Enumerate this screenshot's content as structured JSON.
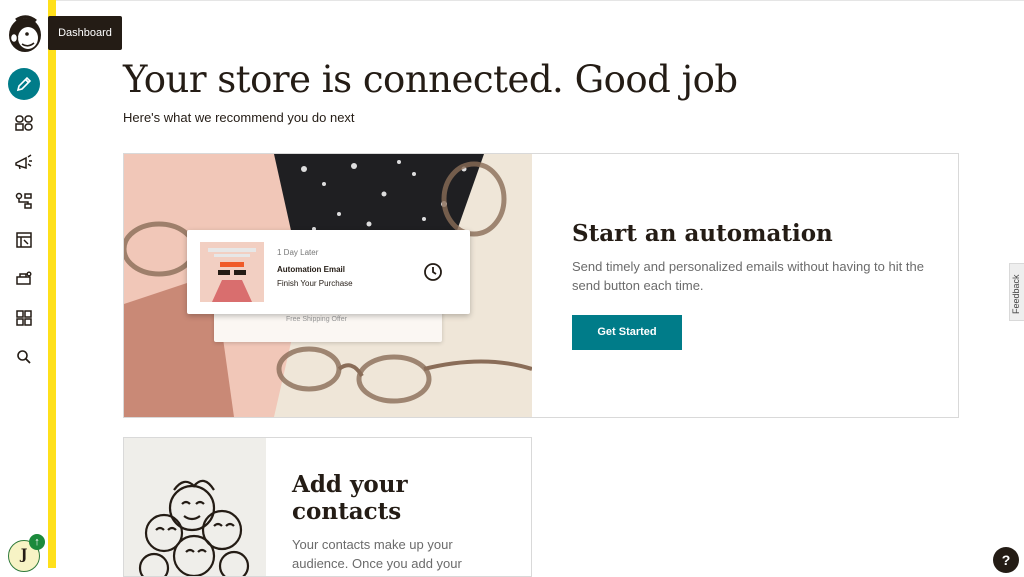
{
  "sidebar": {
    "tooltip": "Dashboard",
    "items": [
      {
        "name": "create-icon",
        "active": true
      },
      {
        "name": "audience-icon",
        "active": false
      },
      {
        "name": "campaigns-icon",
        "active": false
      },
      {
        "name": "automations-icon",
        "active": false
      },
      {
        "name": "website-icon",
        "active": false
      },
      {
        "name": "integrations-icon",
        "active": false
      },
      {
        "name": "content-icon",
        "active": false
      },
      {
        "name": "search-icon",
        "active": false
      }
    ],
    "avatar_initial": "J",
    "avatar_badge": "↑"
  },
  "main": {
    "title": "Your store is connected. Good job",
    "subtitle": "Here's what we recommend you do next"
  },
  "automation_card": {
    "title": "Start an automation",
    "body": "Send timely and personalized emails without having to hit the send button each time.",
    "button": "Get Started",
    "illustration": {
      "delay": "1 Day Later",
      "email_type": "Automation Email",
      "email_subject": "Finish Your Purchase",
      "second_email": "Free Shipping Offer"
    }
  },
  "contacts_card": {
    "title": "Add your contacts",
    "body": "Your contacts make up your audience. Once you add your contacts, you'll be able to send"
  },
  "feedback_label": "Feedback",
  "help_label": "?",
  "colors": {
    "accent": "#007c89",
    "sidebar_stripe": "#ffe01b",
    "text": "#241c15"
  }
}
